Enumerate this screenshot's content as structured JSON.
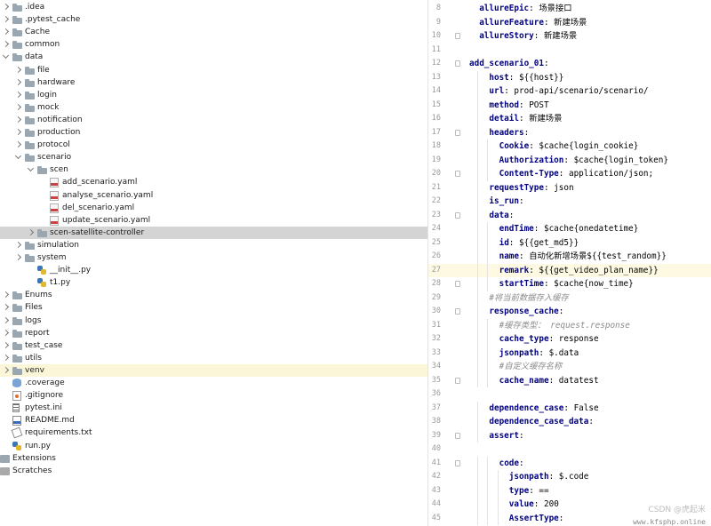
{
  "tree": [
    {
      "label": ".idea",
      "depth": 0,
      "arrow": "collapsed",
      "icon": "folder"
    },
    {
      "label": ".pytest_cache",
      "depth": 0,
      "arrow": "collapsed",
      "icon": "folder"
    },
    {
      "label": "Cache",
      "depth": 0,
      "arrow": "collapsed",
      "icon": "folder"
    },
    {
      "label": "common",
      "depth": 0,
      "arrow": "collapsed",
      "icon": "folder"
    },
    {
      "label": "data",
      "depth": 0,
      "arrow": "expanded",
      "icon": "folder"
    },
    {
      "label": "file",
      "depth": 1,
      "arrow": "collapsed",
      "icon": "folder"
    },
    {
      "label": "hardware",
      "depth": 1,
      "arrow": "collapsed",
      "icon": "folder"
    },
    {
      "label": "login",
      "depth": 1,
      "arrow": "collapsed",
      "icon": "folder"
    },
    {
      "label": "mock",
      "depth": 1,
      "arrow": "collapsed",
      "icon": "folder"
    },
    {
      "label": "notification",
      "depth": 1,
      "arrow": "collapsed",
      "icon": "folder"
    },
    {
      "label": "production",
      "depth": 1,
      "arrow": "collapsed",
      "icon": "folder"
    },
    {
      "label": "protocol",
      "depth": 1,
      "arrow": "collapsed",
      "icon": "folder"
    },
    {
      "label": "scenario",
      "depth": 1,
      "arrow": "expanded",
      "icon": "folder"
    },
    {
      "label": "scen",
      "depth": 2,
      "arrow": "expanded",
      "icon": "folder"
    },
    {
      "label": "add_scenario.yaml",
      "depth": 3,
      "arrow": "none",
      "icon": "yaml"
    },
    {
      "label": "analyse_scenario.yaml",
      "depth": 3,
      "arrow": "none",
      "icon": "yaml"
    },
    {
      "label": "del_scenario.yaml",
      "depth": 3,
      "arrow": "none",
      "icon": "yaml"
    },
    {
      "label": "update_scenario.yaml",
      "depth": 3,
      "arrow": "none",
      "icon": "yaml"
    },
    {
      "label": "scen-satellite-controller",
      "depth": 2,
      "arrow": "collapsed",
      "icon": "folder",
      "state": "selected"
    },
    {
      "label": "simulation",
      "depth": 1,
      "arrow": "collapsed",
      "icon": "folder"
    },
    {
      "label": "system",
      "depth": 1,
      "arrow": "collapsed",
      "icon": "folder"
    },
    {
      "label": "__init__.py",
      "depth": 2,
      "arrow": "none",
      "icon": "py"
    },
    {
      "label": "t1.py",
      "depth": 2,
      "arrow": "none",
      "icon": "py"
    },
    {
      "label": "Enums",
      "depth": 0,
      "arrow": "collapsed",
      "icon": "folder"
    },
    {
      "label": "Files",
      "depth": 0,
      "arrow": "collapsed",
      "icon": "folder"
    },
    {
      "label": "logs",
      "depth": 0,
      "arrow": "collapsed",
      "icon": "folder"
    },
    {
      "label": "report",
      "depth": 0,
      "arrow": "collapsed",
      "icon": "folder"
    },
    {
      "label": "test_case",
      "depth": 0,
      "arrow": "collapsed",
      "icon": "folder"
    },
    {
      "label": "utils",
      "depth": 0,
      "arrow": "collapsed",
      "icon": "folder"
    },
    {
      "label": "venv",
      "depth": 0,
      "arrow": "collapsed",
      "icon": "folder",
      "state": "highlight"
    },
    {
      "label": ".coverage",
      "depth": 0,
      "arrow": "none",
      "icon": "cov"
    },
    {
      "label": ".gitignore",
      "depth": 0,
      "arrow": "none",
      "icon": "git"
    },
    {
      "label": "pytest.ini",
      "depth": 0,
      "arrow": "none",
      "icon": "ini"
    },
    {
      "label": "README.md",
      "depth": 0,
      "arrow": "none",
      "icon": "md"
    },
    {
      "label": "requirements.txt",
      "depth": 0,
      "arrow": "none",
      "icon": "req"
    },
    {
      "label": "run.py",
      "depth": 0,
      "arrow": "none",
      "icon": "py"
    },
    {
      "label": "Extensions",
      "depth": -1,
      "arrow": "collapsed",
      "icon": "ext"
    },
    {
      "label": "Scratches",
      "depth": -1,
      "arrow": "none",
      "icon": "scr"
    }
  ],
  "editor": {
    "current_line": "27",
    "lines": [
      {
        "num": "8",
        "indent": 1,
        "key": "allureEpic",
        "value": " 场景接口",
        "fold": false
      },
      {
        "num": "9",
        "indent": 1,
        "key": "allureFeature",
        "value": " 新建场景",
        "fold": false
      },
      {
        "num": "10",
        "indent": 1,
        "key": "allureStory",
        "value": " 新建场景",
        "fold": true
      },
      {
        "num": "11",
        "indent": 0,
        "key": "",
        "value": "",
        "fold": false
      },
      {
        "num": "12",
        "indent": 0,
        "key": "add_scenario_01",
        "value": "",
        "fold": true
      },
      {
        "num": "13",
        "indent": 2,
        "key": "host",
        "value": " ${{host}}",
        "fold": false
      },
      {
        "num": "14",
        "indent": 2,
        "key": "url",
        "value": " prod-api/scenario/scenario/",
        "fold": false
      },
      {
        "num": "15",
        "indent": 2,
        "key": "method",
        "value": " POST",
        "fold": false
      },
      {
        "num": "16",
        "indent": 2,
        "key": "detail",
        "value": " 新建场景",
        "fold": false
      },
      {
        "num": "17",
        "indent": 2,
        "key": "headers",
        "value": "",
        "fold": true
      },
      {
        "num": "18",
        "indent": 3,
        "key": "Cookie",
        "value": " $cache{login_cookie}",
        "fold": false
      },
      {
        "num": "19",
        "indent": 3,
        "key": "Authorization",
        "value": " $cache{login_token}",
        "fold": false
      },
      {
        "num": "20",
        "indent": 3,
        "key": "Content-Type",
        "value": " application/json;",
        "fold": true
      },
      {
        "num": "21",
        "indent": 2,
        "key": "requestType",
        "value": " json",
        "fold": false
      },
      {
        "num": "22",
        "indent": 2,
        "key": "is_run",
        "value": "",
        "fold": false
      },
      {
        "num": "23",
        "indent": 2,
        "key": "data",
        "value": "",
        "fold": true
      },
      {
        "num": "24",
        "indent": 3,
        "key": "endTime",
        "value": " $cache{onedatetime}",
        "fold": false
      },
      {
        "num": "25",
        "indent": 3,
        "key": "id",
        "value": "  ${{get_md5}}",
        "fold": false
      },
      {
        "num": "26",
        "indent": 3,
        "key": "name",
        "value": " 自动化新增场景${{test_random}}",
        "fold": false
      },
      {
        "num": "27",
        "indent": 3,
        "key": "remark",
        "value": " ${{get_video_plan_name}}",
        "fold": false
      },
      {
        "num": "28",
        "indent": 3,
        "key": "startTime",
        "value": " $cache{now_time}",
        "fold": true
      },
      {
        "num": "29",
        "indent": 2,
        "comment": "#将当前数据存入缓存",
        "fold": false
      },
      {
        "num": "30",
        "indent": 2,
        "key": "response_cache",
        "value": "",
        "fold": true
      },
      {
        "num": "31",
        "indent": 3,
        "comment": "#缓存类型： request.response",
        "fold": false
      },
      {
        "num": "32",
        "indent": 3,
        "key": "cache_type",
        "value": " response",
        "fold": false
      },
      {
        "num": "33",
        "indent": 3,
        "key": "jsonpath",
        "value": " $.data",
        "fold": false
      },
      {
        "num": "34",
        "indent": 3,
        "comment": "#自定义缓存名称",
        "fold": false
      },
      {
        "num": "35",
        "indent": 3,
        "key": "cache_name",
        "value": " datatest",
        "fold": true
      },
      {
        "num": "36",
        "indent": 0,
        "key": "",
        "value": "",
        "fold": false
      },
      {
        "num": "37",
        "indent": 2,
        "key": "dependence_case",
        "value": " False",
        "fold": false
      },
      {
        "num": "38",
        "indent": 2,
        "key": "dependence_case_data",
        "value": "",
        "fold": false
      },
      {
        "num": "39",
        "indent": 2,
        "key": "assert",
        "value": "",
        "fold": true
      },
      {
        "num": "40",
        "indent": 0,
        "key": "",
        "value": "",
        "fold": false
      },
      {
        "num": "41",
        "indent": 3,
        "key": "code",
        "value": "",
        "fold": true
      },
      {
        "num": "42",
        "indent": 4,
        "key": "jsonpath",
        "value": " $.code",
        "fold": false
      },
      {
        "num": "43",
        "indent": 4,
        "key": "type",
        "value": " ==",
        "fold": false
      },
      {
        "num": "44",
        "indent": 4,
        "key": "value",
        "value": " 200",
        "fold": false
      },
      {
        "num": "45",
        "indent": 4,
        "key": "AssertType",
        "value": "",
        "fold": false
      }
    ]
  },
  "watermark": "CSDN @虎起米",
  "watermark2": "www.kfsphp.online",
  "colors": {
    "key": "#000080",
    "comment": "#8c8c8c",
    "selected_row": "#d4d4d4",
    "highlight_row": "#fbf6d8",
    "current_line": "#fdf9e3"
  }
}
